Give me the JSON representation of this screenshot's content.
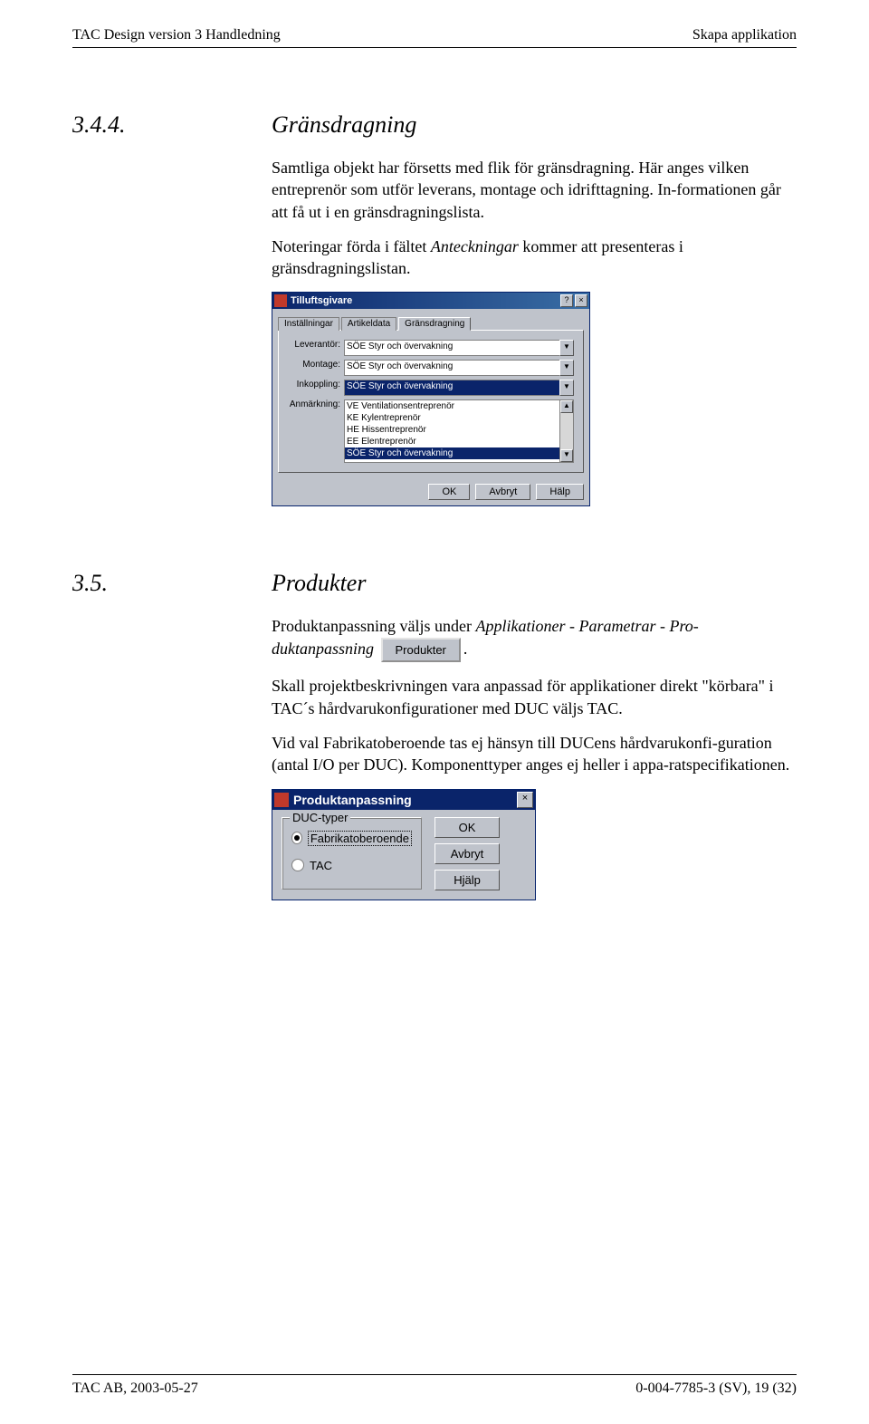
{
  "header": {
    "left": "TAC Design version 3  Handledning",
    "right": "Skapa applikation"
  },
  "sec344": {
    "num": "3.4.4.",
    "title": "Gränsdragning",
    "p1a": "Samtliga objekt har försetts med flik för gränsdragning. Här anges vilken entreprenör som utför leverans, montage och idrifttagning. In-formationen går att få ut i en gränsdragningslista.",
    "p2a": "Noteringar förda i fältet ",
    "p2em": "Anteckningar",
    "p2b": " kommer att presenteras i gränsdragningslistan."
  },
  "dlg1": {
    "title": "Tilluftsgivare",
    "help": "?",
    "close": "×",
    "tabs": [
      "Inställningar",
      "Artikeldata",
      "Gränsdragning"
    ],
    "labels": {
      "lev": "Leverantör:",
      "mon": "Montage:",
      "ink": "Inkoppling:",
      "anm": "Anmärkning:"
    },
    "lev_val": "SÖE Styr och övervakning",
    "mon_val": "SÖE Styr och övervakning",
    "ink_val": "SÖE Styr och övervakning",
    "list": [
      "VE Ventilationsentreprenör",
      "KE Kylentreprenör",
      "HE Hissentreprenör",
      "EE Elentreprenör",
      "SÖE Styr och övervakning"
    ],
    "buttons": {
      "ok": "OK",
      "cancel": "Avbryt",
      "help": "Hälp"
    },
    "arrow": "▼",
    "up": "▲",
    "down": "▼"
  },
  "sec35": {
    "num": "3.5.",
    "title": "Produkter",
    "p1a": "Produktanpassning väljs under ",
    "p1em": "Applikationer -  Parametrar - Pro-duktanpassning",
    "p1b": " ",
    "inline_btn": "Produkter",
    "p1c": ".",
    "p2": "Skall projektbeskrivningen vara anpassad för applikationer direkt \"körbara\" i TAC´s hårdvarukonfigurationer med DUC väljs TAC.",
    "p3": "Vid val Fabrikatoberoende tas ej hänsyn till DUCens hårdvarukonfi-guration (antal I/O per DUC). Komponenttyper anges ej heller i appa-ratspecifikationen."
  },
  "dlg2": {
    "title": "Produktanpassning",
    "close": "×",
    "group": "DUC-typer",
    "opt1": "Fabrikatoberoende",
    "opt2": "TAC",
    "buttons": {
      "ok": "OK",
      "cancel": "Avbryt",
      "help": "Hjälp"
    }
  },
  "footer": {
    "left": "TAC AB, 2003-05-27",
    "right": "0-004-7785-3 (SV), 19 (32)"
  }
}
